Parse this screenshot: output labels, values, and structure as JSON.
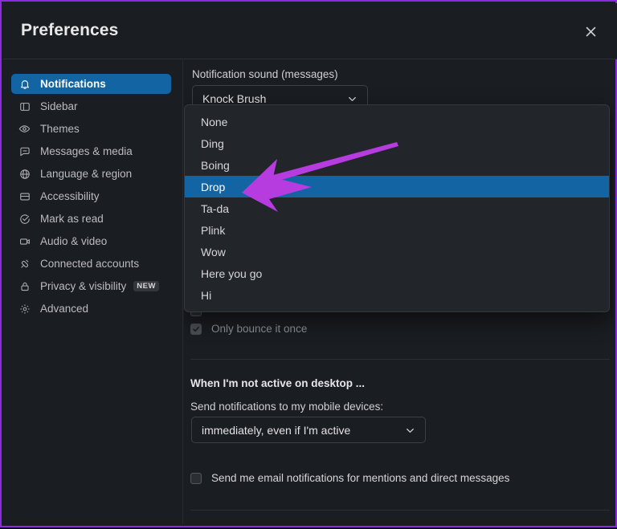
{
  "window": {
    "title": "Preferences",
    "close_icon": "close-icon",
    "accent_blue": "#1264a3",
    "annotation_color": "#b63ce0",
    "background": "#1a1d21"
  },
  "sidebar": {
    "items": [
      {
        "label": "Notifications",
        "icon": "bell-icon",
        "active": true,
        "badge": ""
      },
      {
        "label": "Sidebar",
        "icon": "sidebar-icon",
        "active": false,
        "badge": ""
      },
      {
        "label": "Themes",
        "icon": "eye-icon",
        "active": false,
        "badge": ""
      },
      {
        "label": "Messages & media",
        "icon": "message-icon",
        "active": false,
        "badge": ""
      },
      {
        "label": "Language & region",
        "icon": "globe-icon",
        "active": false,
        "badge": ""
      },
      {
        "label": "Accessibility",
        "icon": "keyboard-icon",
        "active": false,
        "badge": ""
      },
      {
        "label": "Mark as read",
        "icon": "check-circle-icon",
        "active": false,
        "badge": ""
      },
      {
        "label": "Audio & video",
        "icon": "camera-icon",
        "active": false,
        "badge": ""
      },
      {
        "label": "Connected accounts",
        "icon": "plug-icon",
        "active": false,
        "badge": ""
      },
      {
        "label": "Privacy & visibility",
        "icon": "lock-icon",
        "active": false,
        "badge": "NEW"
      },
      {
        "label": "Advanced",
        "icon": "gear-icon",
        "active": false,
        "badge": ""
      }
    ]
  },
  "main": {
    "sound_field": {
      "label": "Notification sound (messages)",
      "value": "Knock Brush",
      "caret_icon": "chevron-down-icon"
    },
    "sound_dropdown": {
      "selected": "Drop",
      "options": [
        "None",
        "Ding",
        "Boing",
        "Drop",
        "Ta-da",
        "Plink",
        "Wow",
        "Here you go",
        "Hi"
      ]
    },
    "bounce_once": {
      "label": "Only bounce it once",
      "checked": true,
      "disabled": true
    },
    "not_active_section": {
      "heading": "When I'm not active on desktop ...",
      "mobile_label": "Send notifications to my mobile devices:",
      "mobile_value": "immediately, even if I'm active",
      "caret_icon": "chevron-down-icon"
    },
    "email_notifications": {
      "label": "Send me email notifications for mentions and direct messages",
      "checked": false
    }
  },
  "annotation": {
    "type": "arrow",
    "color": "#b63ce0",
    "points_to": "Drop"
  }
}
